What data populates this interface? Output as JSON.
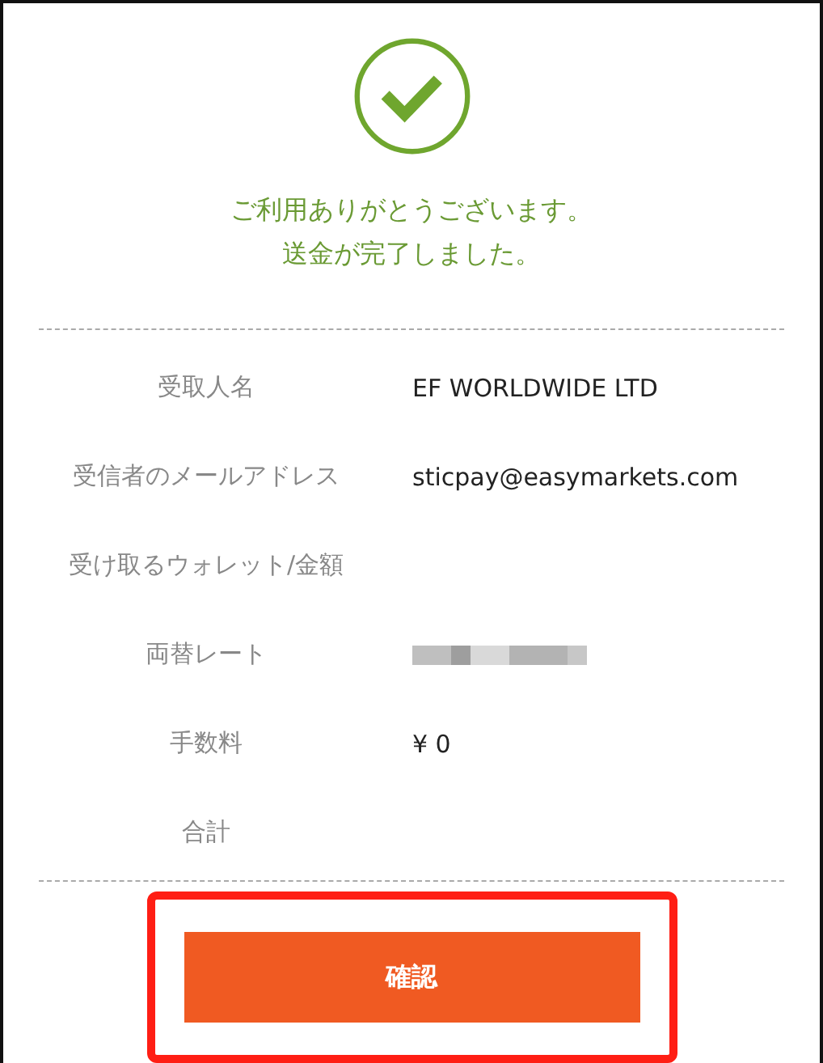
{
  "status": {
    "kind": "success",
    "lines": [
      "ご利用ありがとうございます。",
      "送金が完了しました。"
    ]
  },
  "details": [
    {
      "label": "受取人名",
      "value": "EF WORLDWIDE LTD"
    },
    {
      "label": "受信者のメールアドレス",
      "value": "sticpay@easymarkets.com"
    },
    {
      "label": "受け取るウォレット/金額"
    },
    {
      "label": "両替レート",
      "redacted": true
    },
    {
      "label": "手数料",
      "value": "¥ 0"
    },
    {
      "label": "合計"
    }
  ],
  "confirm_button": {
    "label": "確認",
    "highlighted": true
  }
}
